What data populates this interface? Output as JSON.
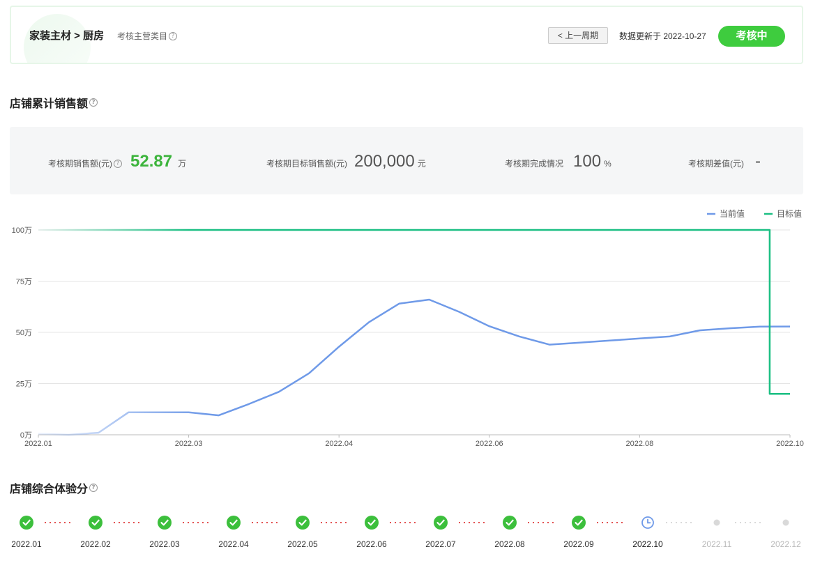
{
  "header": {
    "breadcrumb": "家装主材 > 厨房",
    "subtitle": "考核主营类目",
    "prev_button": "< 上一周期",
    "updated_text": "数据更新于 2022-10-27",
    "status": "考核中",
    "status_color": "#3ecc3e"
  },
  "sales_section": {
    "title": "店铺累计销售额",
    "stats": [
      {
        "label": "考核期销售额(元)",
        "value": "52.87",
        "unit": "万"
      },
      {
        "label": "考核期目标销售额(元)",
        "value": "200,000",
        "unit": "元"
      },
      {
        "label": "考核期完成情况",
        "value": "100",
        "unit": "%"
      },
      {
        "label": "考核期差值(元)",
        "value": "-",
        "unit": ""
      }
    ]
  },
  "chart_data": {
    "type": "line",
    "y_ticks": [
      "0万",
      "25万",
      "50万",
      "75万",
      "100万"
    ],
    "x_ticks": [
      "2022.01",
      "2022.03",
      "2022.04",
      "2022.06",
      "2022.08",
      "2022.10"
    ],
    "ylim": [
      0,
      100
    ],
    "grid": true,
    "legend_position": "top-right",
    "series": [
      {
        "name": "当前值",
        "color": "#6f9ae8",
        "x": [
          0,
          4,
          8,
          12,
          16,
          20,
          24,
          28,
          32,
          36,
          40,
          44,
          48,
          52,
          56,
          60,
          64,
          68,
          72,
          76,
          80,
          84,
          88,
          92,
          96,
          100
        ],
        "values": [
          0.5,
          0,
          1,
          11,
          11,
          11,
          9.5,
          15,
          21,
          30,
          43,
          55,
          64,
          66,
          60,
          53,
          48,
          44,
          45,
          46,
          47,
          48,
          51,
          52,
          52.8,
          52.87
        ]
      },
      {
        "name": "目标值",
        "color": "#1bbf83",
        "x": [
          0,
          97.3,
          97.3,
          100
        ],
        "values": [
          100,
          100,
          20,
          20
        ]
      }
    ]
  },
  "experience_section": {
    "title": "店铺综合体验分",
    "months": [
      {
        "label": "2022.01",
        "state": "done"
      },
      {
        "label": "2022.02",
        "state": "done"
      },
      {
        "label": "2022.03",
        "state": "done"
      },
      {
        "label": "2022.04",
        "state": "done"
      },
      {
        "label": "2022.05",
        "state": "done"
      },
      {
        "label": "2022.06",
        "state": "done"
      },
      {
        "label": "2022.07",
        "state": "done"
      },
      {
        "label": "2022.08",
        "state": "done"
      },
      {
        "label": "2022.09",
        "state": "done"
      },
      {
        "label": "2022.10",
        "state": "current"
      },
      {
        "label": "2022.11",
        "state": "future"
      },
      {
        "label": "2022.12",
        "state": "future"
      }
    ]
  }
}
